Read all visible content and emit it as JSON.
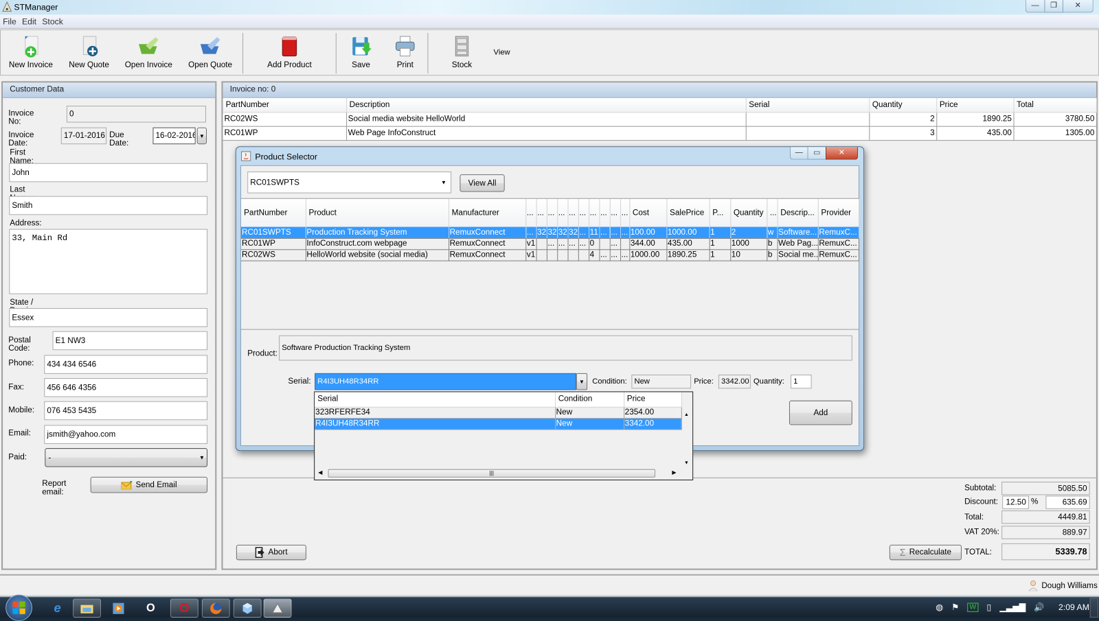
{
  "window": {
    "title": "STManager",
    "controls": {
      "minimize": "—",
      "restore": "❐",
      "close": "✕"
    }
  },
  "menu": [
    "File",
    "Edit",
    "Stock"
  ],
  "toolbar": {
    "new_invoice": "New Invoice",
    "new_quote": "New Quote",
    "open_invoice": "Open Invoice",
    "open_quote": "Open Quote",
    "add_product": "Add Product",
    "save": "Save",
    "print": "Print",
    "stock": "Stock",
    "view": "View"
  },
  "customer": {
    "header": "Customer Data",
    "invoice_no_label": "Invoice No:",
    "invoice_no": "0",
    "invoice_date_label": "Invoice Date:",
    "invoice_date": "17-01-2016",
    "due_date_label": "Due Date:",
    "due_date": "16-02-2016",
    "first_name_label": "First Name:",
    "first_name": "John",
    "last_name_label": "Last Name:",
    "last_name": "Smith",
    "address_label": "Address:",
    "address": "33, Main Rd",
    "state_label": "State / Province:",
    "state": "Essex",
    "postal_label": "Postal Code:",
    "postal": "E1 NW3",
    "phone_label": "Phone:",
    "phone": "434 434 6546",
    "fax_label": "Fax:",
    "fax": "456 646 4356",
    "mobile_label": "Mobile:",
    "mobile": "076 453 5435",
    "email_label": "Email:",
    "email": "jsmith@yahoo.com",
    "paid_label": "Paid:",
    "paid": "-",
    "report_email_label": "Report email:",
    "send_email": "Send Email"
  },
  "invoice": {
    "header": "Invoice no: 0",
    "columns": [
      "PartNumber",
      "Description",
      "Serial",
      "Quantity",
      "Price",
      "Total"
    ],
    "rows": [
      [
        "RC02WS",
        "Social media website HelloWorld",
        "",
        "2",
        "1890.25",
        "3780.50"
      ],
      [
        "RC01WP",
        "Web Page InfoConstruct",
        "",
        "3",
        "435.00",
        "1305.00"
      ]
    ],
    "abort": "Abort",
    "recalculate": "Recalculate",
    "subtotal_label": "Subtotal:",
    "subtotal": "5085.50",
    "discount_label": "Discount:",
    "discount_pct": "12.50",
    "pct_sign": "%",
    "discount_amount": "635.69",
    "total_label": "Total:",
    "total": "4449.81",
    "vat_label": "VAT 20%:",
    "vat": "889.97",
    "grand_total_label": "TOTAL:",
    "grand_total": "5339.78"
  },
  "product_selector": {
    "title": "Product Selector",
    "search_value": "RC01SWPTS",
    "view_all": "View All",
    "columns": [
      "PartNumber",
      "Product",
      "Manufacturer",
      "...",
      "...",
      "...",
      "...",
      "...",
      "...",
      "...",
      "...",
      "...",
      "...",
      "Cost",
      "SalePrice",
      "P...",
      "Quantity",
      "...",
      "Descrip...",
      "Provider"
    ],
    "rows": [
      [
        "RC01SWPTS",
        "Production Tracking System",
        "RemuxConnect",
        "...",
        "32",
        "32",
        "32",
        "32",
        "...",
        "11",
        "...",
        "...",
        "...",
        "100.00",
        "1000.00",
        "1",
        "2",
        "w",
        "Software...",
        "RemuxC..."
      ],
      [
        "RC01WP",
        "InfoConstruct.com webpage",
        "RemuxConnect",
        "v1",
        "",
        "...",
        "...",
        "...",
        "...",
        "0",
        "",
        "...",
        "",
        "344.00",
        "435.00",
        "1",
        "1000",
        "b",
        "Web Pag...",
        "RemuxC..."
      ],
      [
        "RC02WS",
        "HelloWorld website (social media)",
        "RemuxConnect",
        "v1",
        "",
        "",
        "",
        "",
        "",
        "4",
        "...",
        "...",
        "...",
        "1000.00",
        "1890.25",
        "1",
        "10",
        "b",
        "Social me...",
        "RemuxC..."
      ]
    ],
    "selected_row": 0,
    "product_label": "Product:",
    "product_value": "Software Production Tracking System",
    "serial_label": "Serial:",
    "serial_value": "R4I3UH48R34RR",
    "condition_label": "Condition:",
    "condition_value": "New",
    "price_label": "Price:",
    "price_value": "3342.00",
    "quantity_label": "Quantity:",
    "quantity_value": "1",
    "add": "Add",
    "serial_dropdown": {
      "columns": [
        "Serial",
        "Condition",
        "Price"
      ],
      "rows": [
        [
          "323RFERFE34",
          "New",
          "2354.00"
        ],
        [
          "R4I3UH48R34RR",
          "New",
          "3342.00"
        ]
      ],
      "selected_row": 1
    }
  },
  "status": {
    "user": "Dough Williams"
  },
  "taskbar": {
    "clock": "2:09 AM"
  }
}
